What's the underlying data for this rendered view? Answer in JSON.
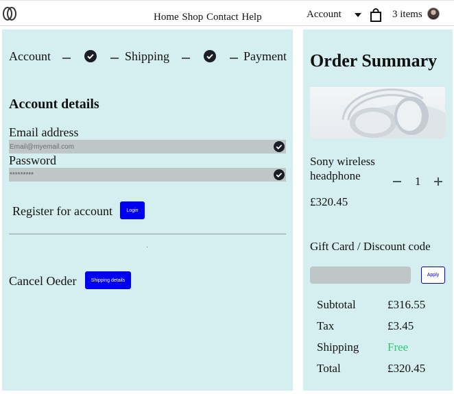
{
  "header": {
    "nav": [
      "Home",
      "Shop",
      "Contact",
      "Help"
    ],
    "account_label": "Account",
    "cart_count_label": "3 items"
  },
  "checkout": {
    "steps": [
      "Account",
      "Shipping",
      "Payment"
    ],
    "account_details_title": "Account details",
    "email_label": "Email address",
    "email_placeholder": "Email@myemail.com",
    "password_label": "Password",
    "password_value": "*********",
    "register_text": "Register for account",
    "login_button": "Login",
    "cancel_text": "Cancel Oeder",
    "shipping_button": "Shipping details"
  },
  "summary": {
    "title": "Order Summary",
    "product": {
      "name": "Sony wireless headphone",
      "quantity": "1",
      "price": "£320.45"
    },
    "gift_label": "Gift Card / Discount code",
    "apply_button": "Apply",
    "rows": [
      {
        "label": "Subtotal",
        "value": "£316.55"
      },
      {
        "label": "Tax",
        "value": "£3.45"
      },
      {
        "label": "Shipping",
        "value": "Free"
      },
      {
        "label": "Total",
        "value": "£320.45"
      }
    ]
  },
  "colors": {
    "panel_bg": "#d5eff0",
    "primary_button": "#0000f0",
    "free_text": "#2ecc71",
    "field_bg": "#bfc6c7"
  },
  "icons": [
    "logo-icon",
    "caret-down-icon",
    "shopping-bag-icon",
    "avatar",
    "checkmark-icon",
    "headphones-image"
  ]
}
